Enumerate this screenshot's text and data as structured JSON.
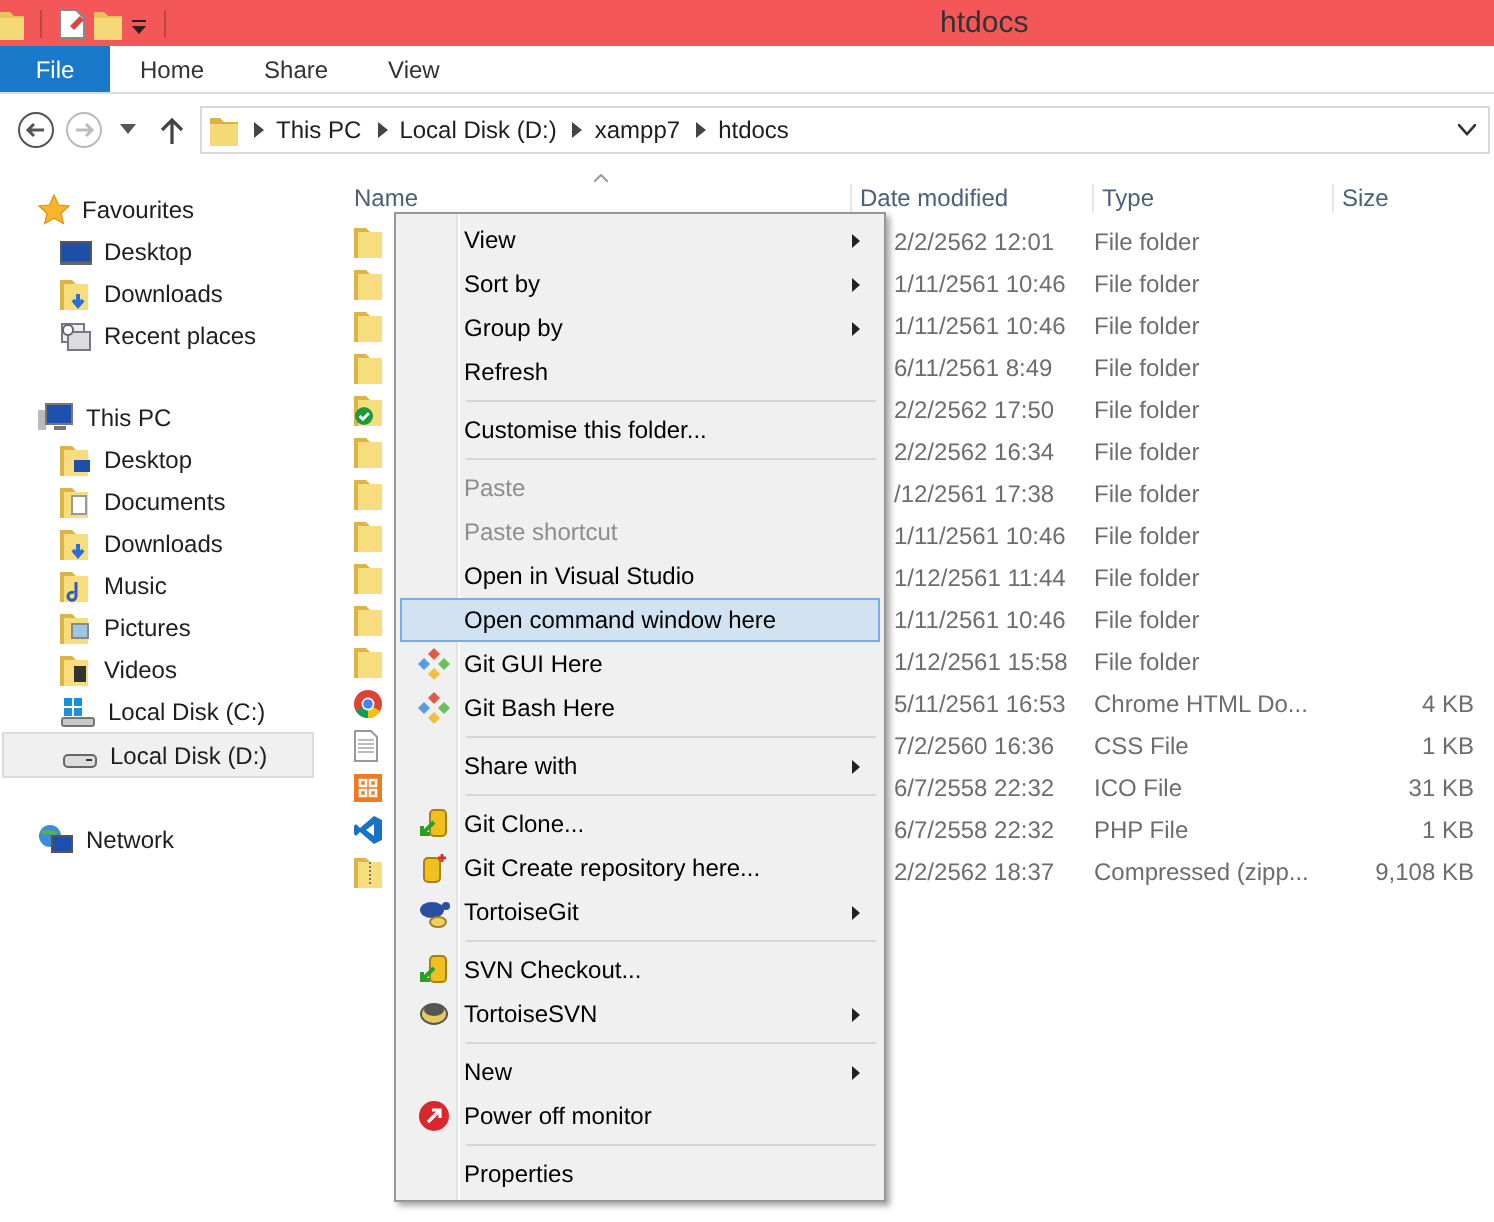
{
  "window": {
    "title": "htdocs"
  },
  "ribbon_tabs": [
    {
      "label": "File",
      "kind": "file",
      "selected": false
    },
    {
      "label": "Home",
      "kind": "tab",
      "selected": false
    },
    {
      "label": "Share",
      "kind": "tab",
      "selected": false
    },
    {
      "label": "View",
      "kind": "tab",
      "selected": false
    }
  ],
  "address_bar": {
    "back_disabled": false,
    "forward_disabled": true,
    "crumbs": [
      "This PC",
      "Local Disk (D:)",
      "xampp7",
      "htdocs"
    ]
  },
  "navigation": [
    {
      "label": "Favourites",
      "kind": "star",
      "selected": false,
      "children": [
        {
          "label": "Desktop",
          "kind": "desktop",
          "selected": false
        },
        {
          "label": "Downloads",
          "kind": "downloads",
          "selected": false
        },
        {
          "label": "Recent places",
          "kind": "recent",
          "selected": false
        }
      ]
    },
    {
      "label": "This PC",
      "kind": "pc",
      "selected": false,
      "children": [
        {
          "label": "Desktop",
          "kind": "desktop-folder",
          "selected": false
        },
        {
          "label": "Documents",
          "kind": "documents",
          "selected": false
        },
        {
          "label": "Downloads",
          "kind": "downloads",
          "selected": false
        },
        {
          "label": "Music",
          "kind": "music",
          "selected": false
        },
        {
          "label": "Pictures",
          "kind": "pictures",
          "selected": false
        },
        {
          "label": "Videos",
          "kind": "videos",
          "selected": false
        },
        {
          "label": "Local Disk (C:)",
          "kind": "system-drive",
          "selected": false
        },
        {
          "label": "Local Disk (D:)",
          "kind": "drive",
          "selected": true
        }
      ]
    },
    {
      "label": "Network",
      "kind": "network",
      "selected": false
    }
  ],
  "file_list": {
    "columns": [
      "Name",
      "Date modified",
      "Type",
      "Size"
    ],
    "rows": [
      {
        "kind": "folder",
        "date": "2/2/2562 12:01",
        "type": "File folder"
      },
      {
        "kind": "folder",
        "date": "1/11/2561 10:46",
        "type": "File folder"
      },
      {
        "kind": "folder",
        "date": "1/11/2561 10:46",
        "type": "File folder"
      },
      {
        "kind": "folder",
        "date": "6/11/2561 8:49",
        "type": "File folder"
      },
      {
        "kind": "folder-synced",
        "date": "2/2/2562 17:50",
        "type": "File folder"
      },
      {
        "kind": "folder",
        "date": "2/2/2562 16:34",
        "type": "File folder"
      },
      {
        "kind": "folder",
        "date": "/12/2561 17:38",
        "type": "File folder"
      },
      {
        "kind": "folder",
        "date": "1/11/2561 10:46",
        "type": "File folder"
      },
      {
        "kind": "folder",
        "date": "1/12/2561 11:44",
        "type": "File folder"
      },
      {
        "kind": "folder",
        "date": "1/11/2561 10:46",
        "type": "File folder"
      },
      {
        "kind": "folder",
        "date": "1/12/2561 15:58",
        "type": "File folder"
      },
      {
        "kind": "chrome",
        "date": "5/11/2561 16:53",
        "type": "Chrome HTML Do...",
        "size": "4 KB"
      },
      {
        "kind": "text",
        "date": "7/2/2560 16:36",
        "type": "CSS File",
        "size": "1 KB"
      },
      {
        "kind": "xampp",
        "date": "6/7/2558 22:32",
        "type": "ICO File",
        "size": "31 KB"
      },
      {
        "kind": "vscode",
        "date": "6/7/2558 22:32",
        "type": "PHP File",
        "size": "1 KB"
      },
      {
        "kind": "zip",
        "date": "2/2/2562 18:37",
        "type": "Compressed (zipp...",
        "size": "9,108 KB"
      }
    ]
  },
  "context_menu": [
    {
      "kind": "plain",
      "label": "View",
      "submenu": true,
      "disabled": false,
      "selected": false
    },
    {
      "kind": "plain",
      "label": "Sort by",
      "submenu": true,
      "disabled": false,
      "selected": false
    },
    {
      "kind": "plain",
      "label": "Group by",
      "submenu": true,
      "disabled": false,
      "selected": false
    },
    {
      "kind": "plain",
      "label": "Refresh",
      "submenu": false,
      "disabled": false,
      "selected": false
    },
    {
      "kind": "separator"
    },
    {
      "kind": "plain",
      "label": "Customise this folder...",
      "submenu": false,
      "disabled": false,
      "selected": false
    },
    {
      "kind": "separator"
    },
    {
      "kind": "plain",
      "label": "Paste",
      "submenu": false,
      "disabled": true,
      "selected": false
    },
    {
      "kind": "plain",
      "label": "Paste shortcut",
      "submenu": false,
      "disabled": true,
      "selected": false
    },
    {
      "kind": "plain",
      "label": "Open in Visual Studio",
      "submenu": false,
      "disabled": false,
      "selected": false
    },
    {
      "kind": "plain",
      "label": "Open command window here",
      "submenu": false,
      "disabled": false,
      "selected": true
    },
    {
      "kind": "git",
      "label": "Git GUI Here",
      "submenu": false,
      "disabled": false,
      "selected": false
    },
    {
      "kind": "git",
      "label": "Git Bash Here",
      "submenu": false,
      "disabled": false,
      "selected": false
    },
    {
      "kind": "separator"
    },
    {
      "kind": "plain",
      "label": "Share with",
      "submenu": true,
      "disabled": false,
      "selected": false
    },
    {
      "kind": "separator"
    },
    {
      "kind": "clone",
      "label": "Git Clone...",
      "submenu": false,
      "disabled": false,
      "selected": false
    },
    {
      "kind": "create-repo",
      "label": "Git Create repository here...",
      "submenu": false,
      "disabled": false,
      "selected": false
    },
    {
      "kind": "tortoise-git",
      "label": "TortoiseGit",
      "submenu": true,
      "disabled": false,
      "selected": false
    },
    {
      "kind": "separator"
    },
    {
      "kind": "clone",
      "label": "SVN Checkout...",
      "submenu": false,
      "disabled": false,
      "selected": false
    },
    {
      "kind": "tortoise-svn",
      "label": "TortoiseSVN",
      "submenu": true,
      "disabled": false,
      "selected": false
    },
    {
      "kind": "separator"
    },
    {
      "kind": "plain",
      "label": "New",
      "submenu": true,
      "disabled": false,
      "selected": false
    },
    {
      "kind": "power",
      "label": "Power off monitor",
      "submenu": false,
      "disabled": false,
      "selected": false
    },
    {
      "kind": "separator"
    },
    {
      "kind": "plain",
      "label": "Properties",
      "submenu": false,
      "disabled": false,
      "selected": false
    }
  ]
}
